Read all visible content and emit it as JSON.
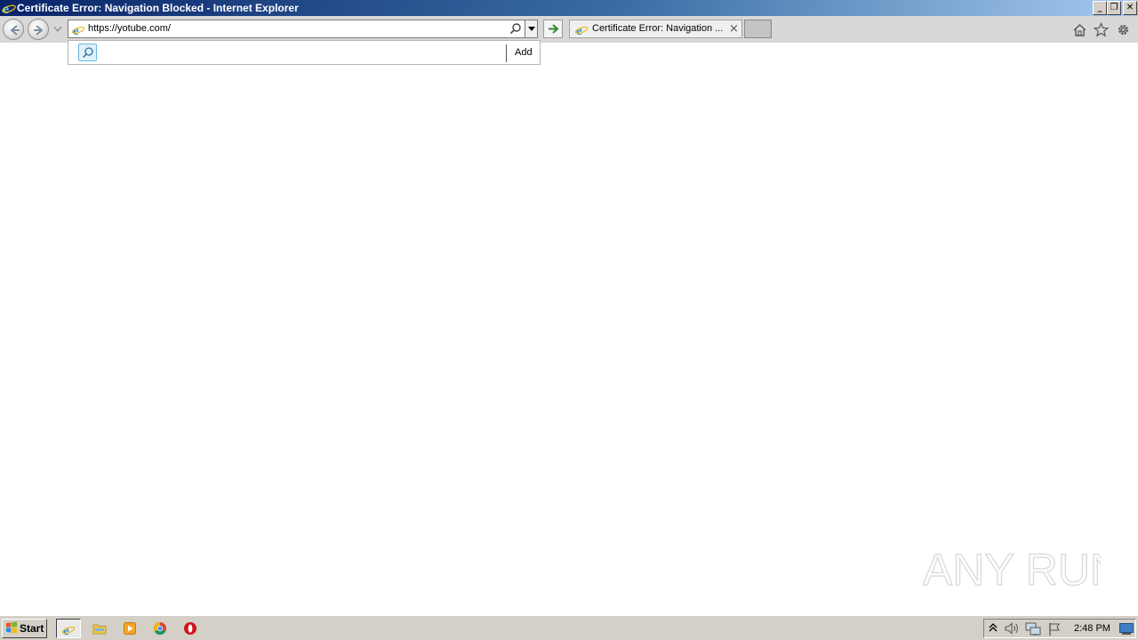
{
  "window": {
    "title": "Certificate Error: Navigation Blocked - Internet Explorer",
    "controls": {
      "minimize": "_",
      "restore": "❐",
      "close": "✕"
    }
  },
  "toolbar": {
    "address_url": "https://yotube.com/",
    "tab_label": "Certificate Error: Navigation ...",
    "tab_close": "×",
    "icons": [
      "back-icon",
      "forward-icon",
      "recent-pages-icon",
      "ie-icon",
      "search-icon",
      "dropdown-icon",
      "go-arrow-icon",
      "home-icon",
      "favorites-star-icon",
      "tools-gear-icon"
    ]
  },
  "suggest": {
    "add_label": "Add"
  },
  "watermark": {
    "text": "ANY RUN"
  },
  "taskbar": {
    "start_label": "Start",
    "clock": "2:48 PM",
    "items": [
      "internet-explorer",
      "file-explorer",
      "media-player",
      "chrome",
      "opera"
    ],
    "tray_icons": [
      "tray-expand-icon",
      "volume-icon",
      "network-icon",
      "action-center-flag-icon",
      "show-desktop-icon"
    ]
  },
  "colors": {
    "titlebar_start": "#0a246a",
    "titlebar_end": "#a6caf0",
    "toolbar_bg": "#d9d8d6",
    "taskbar_bg": "#d4d0c8",
    "go_arrow": "#2e8b2e"
  }
}
